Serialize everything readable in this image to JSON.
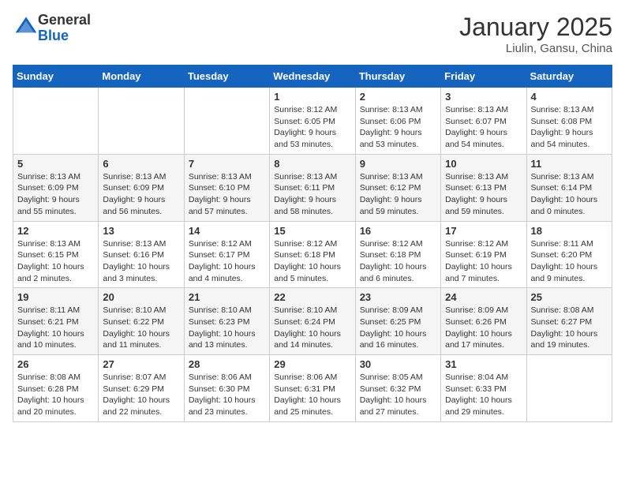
{
  "header": {
    "logo_line1": "General",
    "logo_line2": "Blue",
    "month_title": "January 2025",
    "location": "Liulin, Gansu, China"
  },
  "weekdays": [
    "Sunday",
    "Monday",
    "Tuesday",
    "Wednesday",
    "Thursday",
    "Friday",
    "Saturday"
  ],
  "weeks": [
    [
      {
        "day": "",
        "info": ""
      },
      {
        "day": "",
        "info": ""
      },
      {
        "day": "",
        "info": ""
      },
      {
        "day": "1",
        "info": "Sunrise: 8:12 AM\nSunset: 6:05 PM\nDaylight: 9 hours and 53 minutes."
      },
      {
        "day": "2",
        "info": "Sunrise: 8:13 AM\nSunset: 6:06 PM\nDaylight: 9 hours and 53 minutes."
      },
      {
        "day": "3",
        "info": "Sunrise: 8:13 AM\nSunset: 6:07 PM\nDaylight: 9 hours and 54 minutes."
      },
      {
        "day": "4",
        "info": "Sunrise: 8:13 AM\nSunset: 6:08 PM\nDaylight: 9 hours and 54 minutes."
      }
    ],
    [
      {
        "day": "5",
        "info": "Sunrise: 8:13 AM\nSunset: 6:09 PM\nDaylight: 9 hours and 55 minutes."
      },
      {
        "day": "6",
        "info": "Sunrise: 8:13 AM\nSunset: 6:09 PM\nDaylight: 9 hours and 56 minutes."
      },
      {
        "day": "7",
        "info": "Sunrise: 8:13 AM\nSunset: 6:10 PM\nDaylight: 9 hours and 57 minutes."
      },
      {
        "day": "8",
        "info": "Sunrise: 8:13 AM\nSunset: 6:11 PM\nDaylight: 9 hours and 58 minutes."
      },
      {
        "day": "9",
        "info": "Sunrise: 8:13 AM\nSunset: 6:12 PM\nDaylight: 9 hours and 59 minutes."
      },
      {
        "day": "10",
        "info": "Sunrise: 8:13 AM\nSunset: 6:13 PM\nDaylight: 9 hours and 59 minutes."
      },
      {
        "day": "11",
        "info": "Sunrise: 8:13 AM\nSunset: 6:14 PM\nDaylight: 10 hours and 0 minutes."
      }
    ],
    [
      {
        "day": "12",
        "info": "Sunrise: 8:13 AM\nSunset: 6:15 PM\nDaylight: 10 hours and 2 minutes."
      },
      {
        "day": "13",
        "info": "Sunrise: 8:13 AM\nSunset: 6:16 PM\nDaylight: 10 hours and 3 minutes."
      },
      {
        "day": "14",
        "info": "Sunrise: 8:12 AM\nSunset: 6:17 PM\nDaylight: 10 hours and 4 minutes."
      },
      {
        "day": "15",
        "info": "Sunrise: 8:12 AM\nSunset: 6:18 PM\nDaylight: 10 hours and 5 minutes."
      },
      {
        "day": "16",
        "info": "Sunrise: 8:12 AM\nSunset: 6:18 PM\nDaylight: 10 hours and 6 minutes."
      },
      {
        "day": "17",
        "info": "Sunrise: 8:12 AM\nSunset: 6:19 PM\nDaylight: 10 hours and 7 minutes."
      },
      {
        "day": "18",
        "info": "Sunrise: 8:11 AM\nSunset: 6:20 PM\nDaylight: 10 hours and 9 minutes."
      }
    ],
    [
      {
        "day": "19",
        "info": "Sunrise: 8:11 AM\nSunset: 6:21 PM\nDaylight: 10 hours and 10 minutes."
      },
      {
        "day": "20",
        "info": "Sunrise: 8:10 AM\nSunset: 6:22 PM\nDaylight: 10 hours and 11 minutes."
      },
      {
        "day": "21",
        "info": "Sunrise: 8:10 AM\nSunset: 6:23 PM\nDaylight: 10 hours and 13 minutes."
      },
      {
        "day": "22",
        "info": "Sunrise: 8:10 AM\nSunset: 6:24 PM\nDaylight: 10 hours and 14 minutes."
      },
      {
        "day": "23",
        "info": "Sunrise: 8:09 AM\nSunset: 6:25 PM\nDaylight: 10 hours and 16 minutes."
      },
      {
        "day": "24",
        "info": "Sunrise: 8:09 AM\nSunset: 6:26 PM\nDaylight: 10 hours and 17 minutes."
      },
      {
        "day": "25",
        "info": "Sunrise: 8:08 AM\nSunset: 6:27 PM\nDaylight: 10 hours and 19 minutes."
      }
    ],
    [
      {
        "day": "26",
        "info": "Sunrise: 8:08 AM\nSunset: 6:28 PM\nDaylight: 10 hours and 20 minutes."
      },
      {
        "day": "27",
        "info": "Sunrise: 8:07 AM\nSunset: 6:29 PM\nDaylight: 10 hours and 22 minutes."
      },
      {
        "day": "28",
        "info": "Sunrise: 8:06 AM\nSunset: 6:30 PM\nDaylight: 10 hours and 23 minutes."
      },
      {
        "day": "29",
        "info": "Sunrise: 8:06 AM\nSunset: 6:31 PM\nDaylight: 10 hours and 25 minutes."
      },
      {
        "day": "30",
        "info": "Sunrise: 8:05 AM\nSunset: 6:32 PM\nDaylight: 10 hours and 27 minutes."
      },
      {
        "day": "31",
        "info": "Sunrise: 8:04 AM\nSunset: 6:33 PM\nDaylight: 10 hours and 29 minutes."
      },
      {
        "day": "",
        "info": ""
      }
    ]
  ]
}
